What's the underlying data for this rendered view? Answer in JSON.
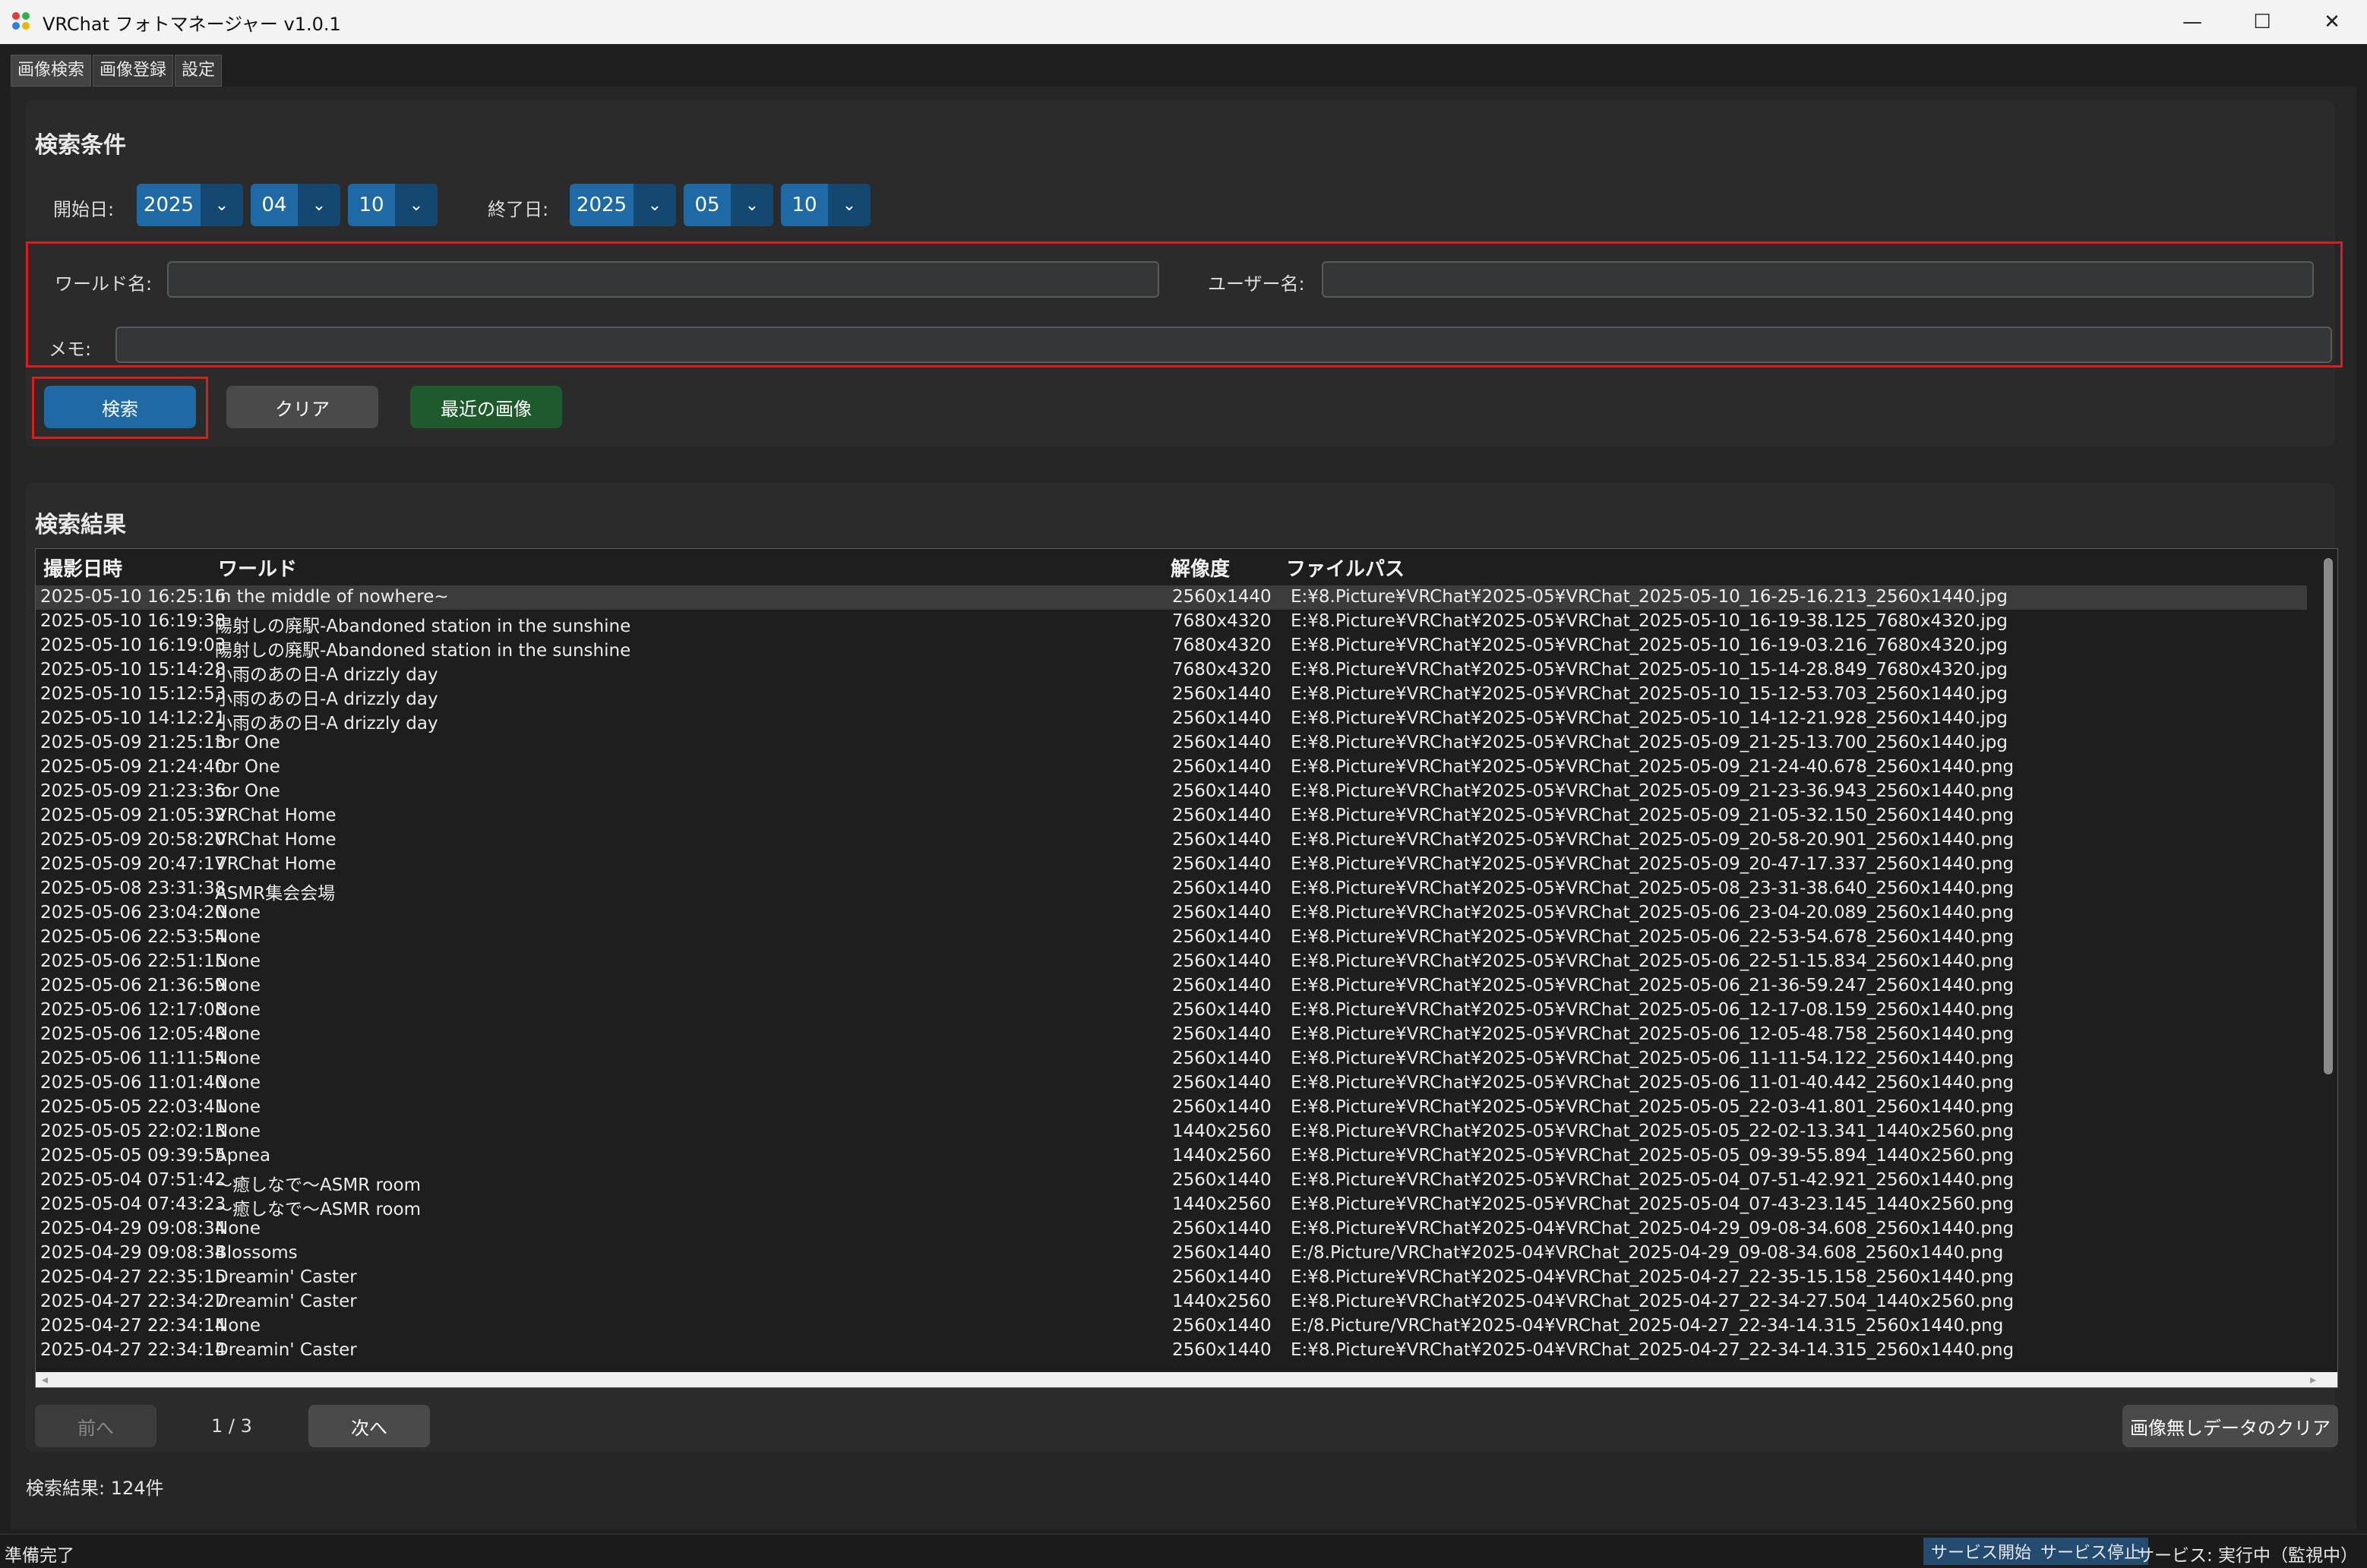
{
  "window": {
    "title": "VRChat フォトマネージャー v1.0.1",
    "minimize": "—",
    "maximize": "☐",
    "close": "✕"
  },
  "tabs": [
    {
      "label": "画像検索"
    },
    {
      "label": "画像登録"
    },
    {
      "label": "設定"
    }
  ],
  "search": {
    "title": "検索条件",
    "start_label": "開始日:",
    "start": {
      "year": "2025",
      "month": "04",
      "day": "10"
    },
    "end_label": "終了日:",
    "end": {
      "year": "2025",
      "month": "05",
      "day": "10"
    },
    "world_label": "ワールド名:",
    "world_value": "",
    "user_label": "ユーザー名:",
    "user_value": "",
    "memo_label": "メモ:",
    "memo_value": "",
    "search_button": "検索",
    "clear_button": "クリア",
    "recent_button": "最近の画像"
  },
  "results": {
    "title": "検索結果",
    "columns": [
      "撮影日時",
      "ワールド",
      "解像度",
      "ファイルパス"
    ],
    "rows": [
      [
        "2025-05-10 16:25:16",
        "In the middle of nowhere~",
        "2560x1440",
        "E:¥8.Picture¥VRChat¥2025-05¥VRChat_2025-05-10_16-25-16.213_2560x1440.jpg"
      ],
      [
        "2025-05-10 16:19:38",
        "陽射しの廃駅-Abandoned station in the sunshine",
        "7680x4320",
        "E:¥8.Picture¥VRChat¥2025-05¥VRChat_2025-05-10_16-19-38.125_7680x4320.jpg"
      ],
      [
        "2025-05-10 16:19:03",
        "陽射しの廃駅-Abandoned station in the sunshine",
        "7680x4320",
        "E:¥8.Picture¥VRChat¥2025-05¥VRChat_2025-05-10_16-19-03.216_7680x4320.jpg"
      ],
      [
        "2025-05-10 15:14:28",
        "小雨のあの日-A drizzly day",
        "7680x4320",
        "E:¥8.Picture¥VRChat¥2025-05¥VRChat_2025-05-10_15-14-28.849_7680x4320.jpg"
      ],
      [
        "2025-05-10 15:12:53",
        "小雨のあの日-A drizzly day",
        "2560x1440",
        "E:¥8.Picture¥VRChat¥2025-05¥VRChat_2025-05-10_15-12-53.703_2560x1440.jpg"
      ],
      [
        "2025-05-10 14:12:21",
        "小雨のあの日-A drizzly day",
        "2560x1440",
        "E:¥8.Picture¥VRChat¥2025-05¥VRChat_2025-05-10_14-12-21.928_2560x1440.jpg"
      ],
      [
        "2025-05-09 21:25:13",
        "for One",
        "2560x1440",
        "E:¥8.Picture¥VRChat¥2025-05¥VRChat_2025-05-09_21-25-13.700_2560x1440.jpg"
      ],
      [
        "2025-05-09 21:24:40",
        "for One",
        "2560x1440",
        "E:¥8.Picture¥VRChat¥2025-05¥VRChat_2025-05-09_21-24-40.678_2560x1440.png"
      ],
      [
        "2025-05-09 21:23:36",
        "for One",
        "2560x1440",
        "E:¥8.Picture¥VRChat¥2025-05¥VRChat_2025-05-09_21-23-36.943_2560x1440.png"
      ],
      [
        "2025-05-09 21:05:32",
        "VRChat Home",
        "2560x1440",
        "E:¥8.Picture¥VRChat¥2025-05¥VRChat_2025-05-09_21-05-32.150_2560x1440.png"
      ],
      [
        "2025-05-09 20:58:20",
        "VRChat Home",
        "2560x1440",
        "E:¥8.Picture¥VRChat¥2025-05¥VRChat_2025-05-09_20-58-20.901_2560x1440.png"
      ],
      [
        "2025-05-09 20:47:17",
        "VRChat Home",
        "2560x1440",
        "E:¥8.Picture¥VRChat¥2025-05¥VRChat_2025-05-09_20-47-17.337_2560x1440.png"
      ],
      [
        "2025-05-08 23:31:38",
        "ASMR集会会場",
        "2560x1440",
        "E:¥8.Picture¥VRChat¥2025-05¥VRChat_2025-05-08_23-31-38.640_2560x1440.png"
      ],
      [
        "2025-05-06 23:04:20",
        "None",
        "2560x1440",
        "E:¥8.Picture¥VRChat¥2025-05¥VRChat_2025-05-06_23-04-20.089_2560x1440.png"
      ],
      [
        "2025-05-06 22:53:54",
        "None",
        "2560x1440",
        "E:¥8.Picture¥VRChat¥2025-05¥VRChat_2025-05-06_22-53-54.678_2560x1440.png"
      ],
      [
        "2025-05-06 22:51:15",
        "None",
        "2560x1440",
        "E:¥8.Picture¥VRChat¥2025-05¥VRChat_2025-05-06_22-51-15.834_2560x1440.png"
      ],
      [
        "2025-05-06 21:36:59",
        "None",
        "2560x1440",
        "E:¥8.Picture¥VRChat¥2025-05¥VRChat_2025-05-06_21-36-59.247_2560x1440.png"
      ],
      [
        "2025-05-06 12:17:08",
        "None",
        "2560x1440",
        "E:¥8.Picture¥VRChat¥2025-05¥VRChat_2025-05-06_12-17-08.159_2560x1440.png"
      ],
      [
        "2025-05-06 12:05:48",
        "None",
        "2560x1440",
        "E:¥8.Picture¥VRChat¥2025-05¥VRChat_2025-05-06_12-05-48.758_2560x1440.png"
      ],
      [
        "2025-05-06 11:11:54",
        "None",
        "2560x1440",
        "E:¥8.Picture¥VRChat¥2025-05¥VRChat_2025-05-06_11-11-54.122_2560x1440.png"
      ],
      [
        "2025-05-06 11:01:40",
        "None",
        "2560x1440",
        "E:¥8.Picture¥VRChat¥2025-05¥VRChat_2025-05-06_11-01-40.442_2560x1440.png"
      ],
      [
        "2025-05-05 22:03:41",
        "None",
        "2560x1440",
        "E:¥8.Picture¥VRChat¥2025-05¥VRChat_2025-05-05_22-03-41.801_2560x1440.png"
      ],
      [
        "2025-05-05 22:02:13",
        "None",
        "1440x2560",
        "E:¥8.Picture¥VRChat¥2025-05¥VRChat_2025-05-05_22-02-13.341_1440x2560.png"
      ],
      [
        "2025-05-05 09:39:55",
        "Apnea",
        "1440x2560",
        "E:¥8.Picture¥VRChat¥2025-05¥VRChat_2025-05-05_09-39-55.894_1440x2560.png"
      ],
      [
        "2025-05-04 07:51:42",
        "～癒しなで～ASMR room",
        "2560x1440",
        "E:¥8.Picture¥VRChat¥2025-05¥VRChat_2025-05-04_07-51-42.921_2560x1440.png"
      ],
      [
        "2025-05-04 07:43:23",
        "～癒しなで～ASMR room",
        "1440x2560",
        "E:¥8.Picture¥VRChat¥2025-05¥VRChat_2025-05-04_07-43-23.145_1440x2560.png"
      ],
      [
        "2025-04-29 09:08:34",
        "None",
        "2560x1440",
        "E:¥8.Picture¥VRChat¥2025-04¥VRChat_2025-04-29_09-08-34.608_2560x1440.png"
      ],
      [
        "2025-04-29 09:08:34",
        "Blossoms",
        "2560x1440",
        "E:/8.Picture/VRChat¥2025-04¥VRChat_2025-04-29_09-08-34.608_2560x1440.png"
      ],
      [
        "2025-04-27 22:35:15",
        "Dreamin' Caster",
        "2560x1440",
        "E:¥8.Picture¥VRChat¥2025-04¥VRChat_2025-04-27_22-35-15.158_2560x1440.png"
      ],
      [
        "2025-04-27 22:34:27",
        "Dreamin' Caster",
        "1440x2560",
        "E:¥8.Picture¥VRChat¥2025-04¥VRChat_2025-04-27_22-34-27.504_1440x2560.png"
      ],
      [
        "2025-04-27 22:34:14",
        "None",
        "2560x1440",
        "E:/8.Picture/VRChat¥2025-04¥VRChat_2025-04-27_22-34-14.315_2560x1440.png"
      ],
      [
        "2025-04-27 22:34:14",
        "Dreamin' Caster",
        "2560x1440",
        "E:¥8.Picture¥VRChat¥2025-04¥VRChat_2025-04-27_22-34-14.315_2560x1440.png"
      ]
    ],
    "prev_button": "前へ",
    "page": "1 / 3",
    "next_button": "次へ",
    "clear_no_image_button": "画像無しデータのクリア",
    "count_text": "検索結果: 124件"
  },
  "status": {
    "message": "準備完了",
    "start_service": "サービス開始",
    "stop_service": "サービス停止",
    "service_state": "サービス: 実行中（監視中）"
  },
  "colors": {
    "accent": "#1f6aa5",
    "accent_dark": "#144870",
    "highlight": "#d61f1f",
    "recent": "#1f5a2c"
  }
}
